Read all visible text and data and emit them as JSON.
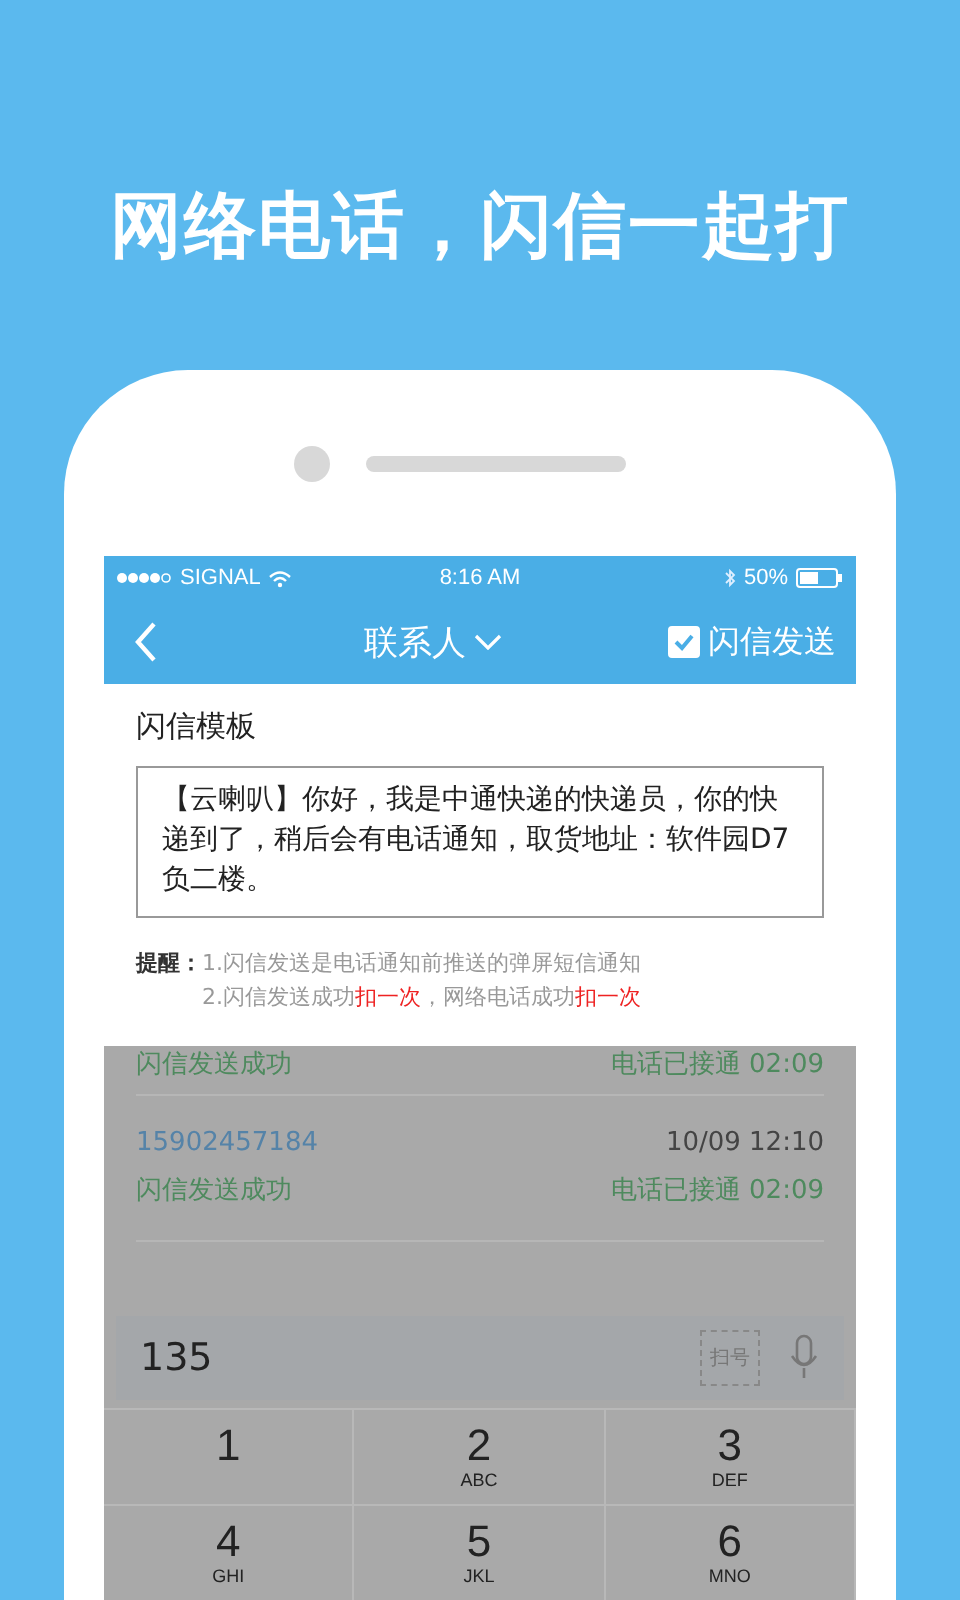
{
  "headline": "网络电话，闪信一起打",
  "status_bar": {
    "carrier": "SIGNAL",
    "time": "8:16 AM",
    "battery": "50%"
  },
  "nav": {
    "title": "联系人",
    "flash_toggle": {
      "label": "闪信发送",
      "checked": true
    }
  },
  "template_dialog": {
    "title": "闪信模板",
    "message": "【云喇叭】你好，我是中通快递的快递员，你的快递到了，稍后会有电话通知，取货地址：软件园D7负二楼。",
    "reminder_label": "提醒：",
    "reminder_lines": [
      [
        {
          "text": "1.闪信发送是电话通知前推送的弹屏短信通知",
          "highlight": false
        }
      ],
      [
        {
          "text": "2.闪信发送成功",
          "highlight": false
        },
        {
          "text": "扣一次",
          "highlight": true
        },
        {
          "text": "，网络电话成功",
          "highlight": false
        },
        {
          "text": "扣一次",
          "highlight": true
        }
      ]
    ]
  },
  "call_log": [
    {
      "status": "闪信发送成功",
      "call_result": "电话已接通 02:09"
    },
    {
      "number": "15902457184",
      "time": "10/09 12:10",
      "status": "闪信发送成功",
      "call_result": "电话已接通 02:09"
    }
  ],
  "dialer": {
    "input": "135",
    "scan_label": "扫号",
    "keys": [
      {
        "digit": "1"
      },
      {
        "digit": "2",
        "letters": "ABC"
      },
      {
        "digit": "3",
        "letters": "DEF"
      },
      {
        "digit": "4",
        "letters": "GHI"
      },
      {
        "digit": "5",
        "letters": "JKL"
      },
      {
        "digit": "6",
        "letters": "MNO"
      }
    ]
  }
}
